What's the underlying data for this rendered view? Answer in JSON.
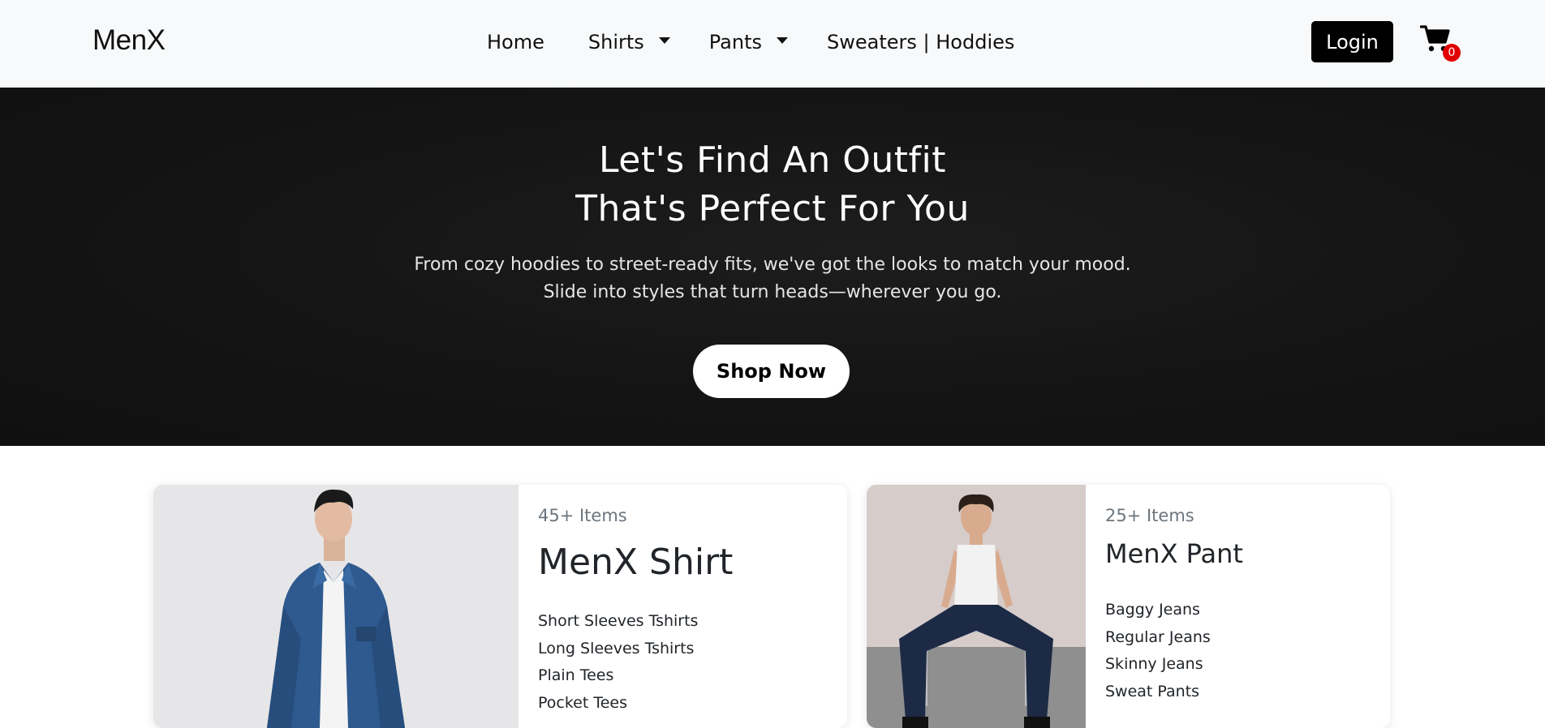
{
  "navbar": {
    "brand": "MenX",
    "links": [
      "Home",
      "Shirts",
      "Pants",
      "Sweaters | Hoddies"
    ],
    "login_label": "Login",
    "cart_count": "0"
  },
  "hero": {
    "title_line1": "Let's Find An Outfit",
    "title_line2": "That's Perfect For You",
    "subtitle_line1": "From cozy hoodies to street-ready fits, we've got the looks to match your mood.",
    "subtitle_line2": "Slide into styles that turn heads—wherever you go.",
    "cta_label": "Shop Now"
  },
  "cards": [
    {
      "count": "45+ Items",
      "title": "MenX Shirt",
      "items": [
        "Short Sleeves Tshirts",
        "Long Sleeves Tshirts",
        "Plain Tees",
        "Pocket Tees"
      ]
    },
    {
      "count": "25+ Items",
      "title": "MenX Pant",
      "items": [
        "Baggy Jeans",
        "Regular Jeans",
        "Skinny Jeans",
        "Sweat Pants"
      ]
    }
  ],
  "colors": {
    "navbar_bg": "#f8f9fa",
    "hero_bg": "#141414",
    "badge": "#e00000",
    "login_bg": "#000000"
  },
  "icons": {
    "cart": "shopping-cart-icon",
    "dropdown": "caret-down-icon"
  }
}
